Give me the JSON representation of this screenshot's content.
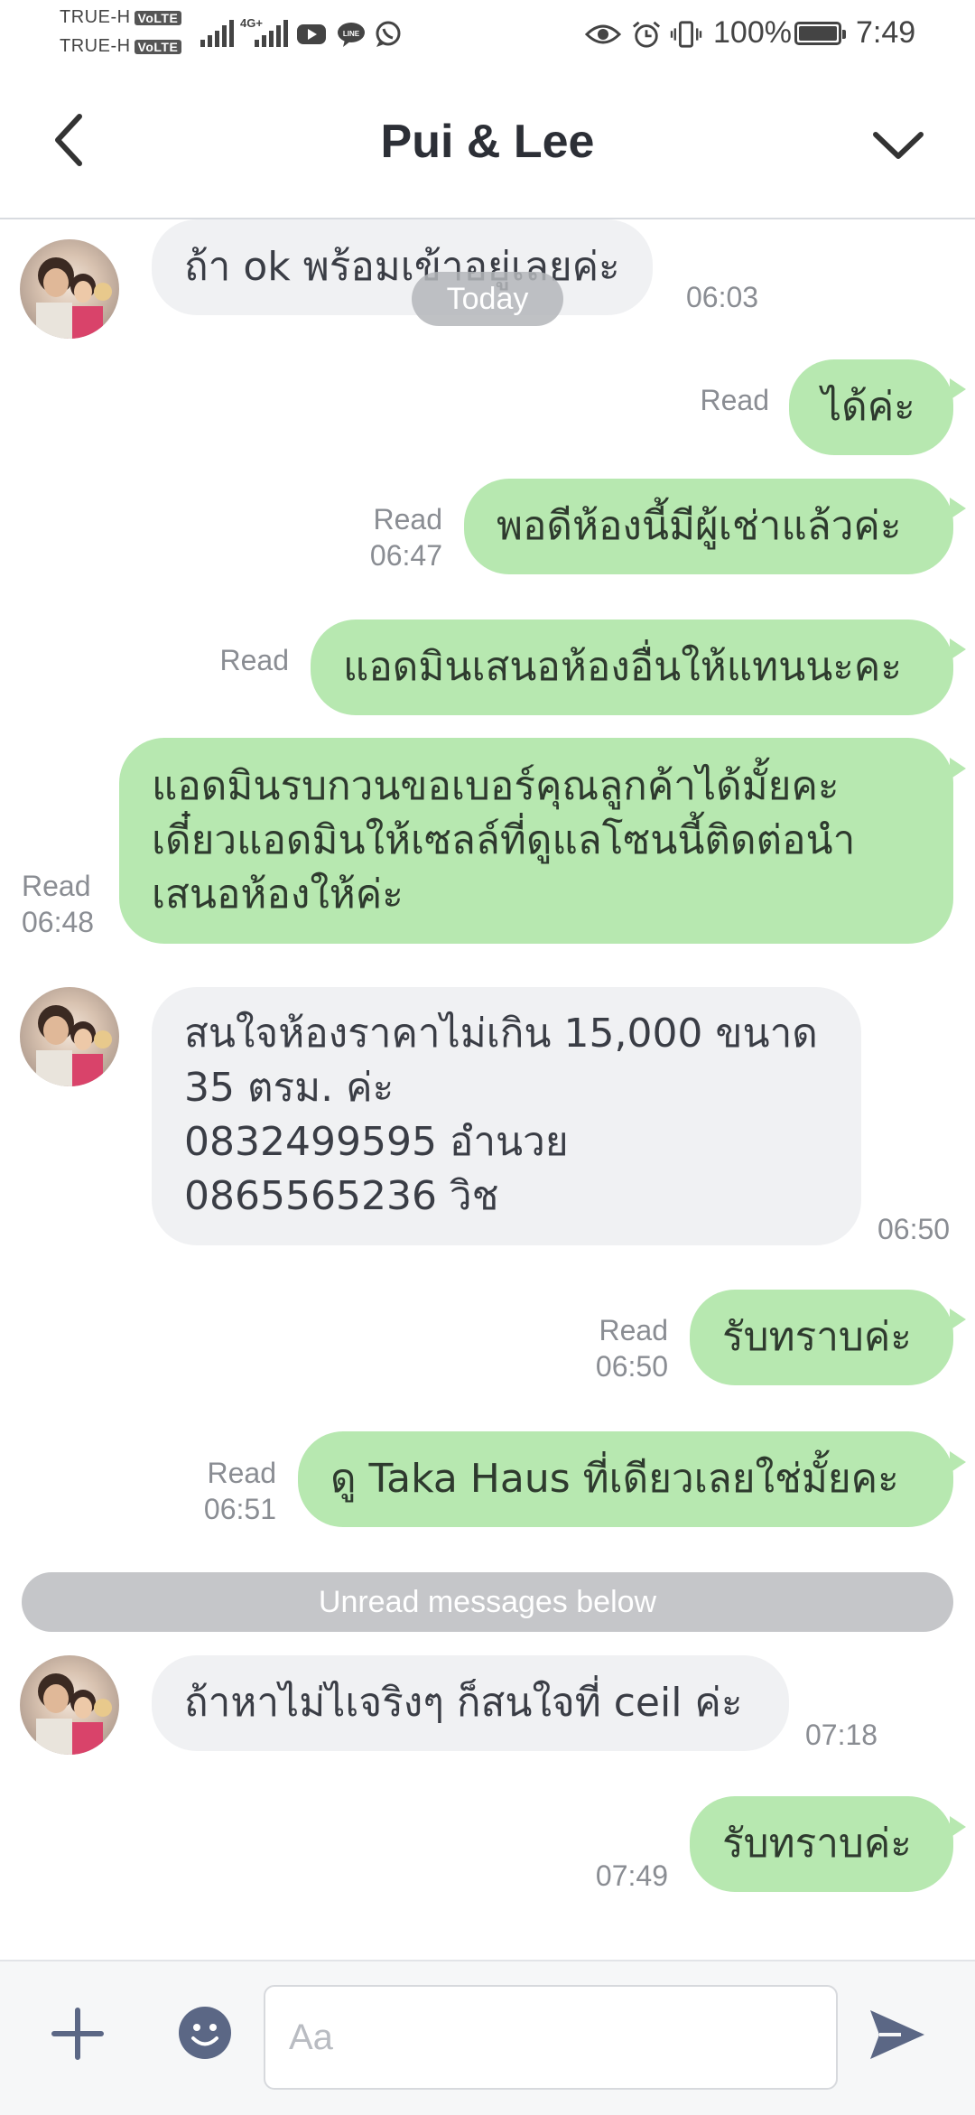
{
  "status_bar": {
    "carrier1": "TRUE-H",
    "carrier2": "TRUE-H",
    "volte": "VoLTE",
    "network": "4G+",
    "battery": "100%",
    "time": "7:49"
  },
  "header": {
    "title": "Pui & Lee"
  },
  "chat": {
    "today_label": "Today",
    "unread_label": "Unread messages below",
    "messages": [
      {
        "dir": "in",
        "text": "ถ้า ok พร้อมเข้าอยู่เลยค่ะ",
        "time": "06:03"
      },
      {
        "dir": "out",
        "text": "ได้ค่ะ",
        "read": "Read",
        "time": ""
      },
      {
        "dir": "out",
        "text": "พอดีห้องนี้มีผู้เช่าแล้วค่ะ",
        "read": "Read",
        "time": "06:47"
      },
      {
        "dir": "out",
        "text": "แอดมินเสนอห้องอื่นให้แทนนะคะ",
        "read": "Read",
        "time": ""
      },
      {
        "dir": "out",
        "lines": [
          "แอดมินรบกวนขอเบอร์คุณลูกค้าได้มั้ยคะ",
          "เดี๋ยวแอดมินให้เซลล์ที่ดูแลโซนนี้ติดต่อนำ",
          "เสนอห้องให้ค่ะ"
        ],
        "read": "Read",
        "time": "06:48"
      },
      {
        "dir": "in",
        "lines": [
          "สนใจห้องราคาไม่เกิน 15,000 ขนาด",
          "35 ตรม. ค่ะ",
          "0832499595  อำนวย",
          "0865565236 วิช"
        ],
        "time": "06:50"
      },
      {
        "dir": "out",
        "text": "รับทราบค่ะ",
        "read": "Read",
        "time": "06:50"
      },
      {
        "dir": "out",
        "text": "ดู Taka Haus ที่เดียวเลยใช่มั้ยคะ",
        "read": "Read",
        "time": "06:51"
      },
      {
        "dir": "in",
        "text": "ถ้าหาไม่ไเจริงๆ ก็สนใจที่ ceil ค่ะ",
        "time": "07:18"
      },
      {
        "dir": "out",
        "text": "รับทราบค่ะ",
        "read": "",
        "time": "07:49"
      }
    ]
  },
  "input": {
    "placeholder": "Aa"
  },
  "colors": {
    "outgoing_bubble": "#b7e8b0",
    "incoming_bubble": "#f0f1f3",
    "icon": "#5b6785"
  }
}
